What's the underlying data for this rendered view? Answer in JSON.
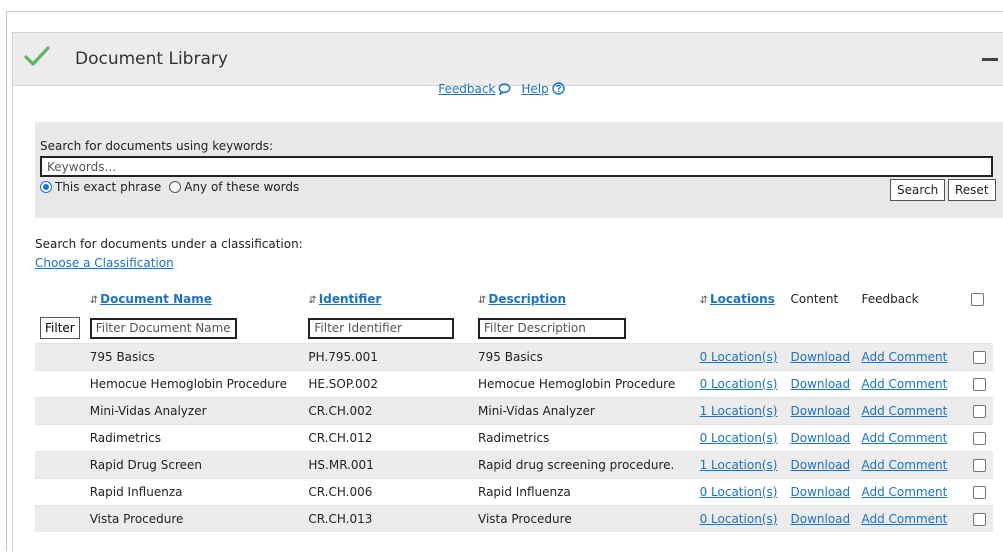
{
  "panel": {
    "title": "Document Library",
    "minimize_icon": "minus-icon",
    "status_icon": "check-icon",
    "accent_color": "#5cb85c"
  },
  "links": {
    "feedback": "Feedback",
    "feedback_icon": "speech-bubble-icon",
    "help": "Help",
    "help_icon": "question-circle-icon"
  },
  "search": {
    "label": "Search for documents using keywords:",
    "placeholder": "Keywords...",
    "value": "",
    "options": [
      {
        "label": "This exact phrase",
        "selected": true
      },
      {
        "label": "Any of these words",
        "selected": false
      }
    ],
    "search_button": "Search",
    "reset_button": "Reset"
  },
  "classification": {
    "label": "Search for documents under a classification:",
    "link": "Choose a Classification"
  },
  "table": {
    "headers": {
      "name": "Document Name",
      "identifier": "Identifier",
      "description": "Description",
      "locations": "Locations",
      "content": "Content",
      "feedback": "Feedback"
    },
    "filter_button": "Filter",
    "filters": {
      "name": "Filter Document Name",
      "identifier": "Filter Identifier",
      "description": "Filter Description"
    },
    "rows": [
      {
        "name": "795 Basics",
        "identifier": "PH.795.001",
        "description": "795 Basics",
        "locations": "0 Location(s)",
        "content": "Download",
        "feedback": "Add Comment"
      },
      {
        "name": "Hemocue Hemoglobin Procedure",
        "identifier": "HE.SOP.002",
        "description": "Hemocue Hemoglobin Procedure",
        "locations": "0 Location(s)",
        "content": "Download",
        "feedback": "Add Comment"
      },
      {
        "name": "Mini-Vidas Analyzer",
        "identifier": "CR.CH.002",
        "description": "Mini-Vidas Analyzer",
        "locations": "1 Location(s)",
        "content": "Download",
        "feedback": "Add Comment"
      },
      {
        "name": "Radimetrics",
        "identifier": "CR.CH.012",
        "description": "Radimetrics",
        "locations": "0 Location(s)",
        "content": "Download",
        "feedback": "Add Comment"
      },
      {
        "name": "Rapid Drug Screen",
        "identifier": "HS.MR.001",
        "description": "Rapid drug screening procedure.",
        "locations": "1 Location(s)",
        "content": "Download",
        "feedback": "Add Comment"
      },
      {
        "name": "Rapid Influenza",
        "identifier": "CR.CH.006",
        "description": "Rapid Influenza",
        "locations": "0 Location(s)",
        "content": "Download",
        "feedback": "Add Comment"
      },
      {
        "name": "Vista Procedure",
        "identifier": "CR.CH.013",
        "description": "Vista Procedure",
        "locations": "0 Location(s)",
        "content": "Download",
        "feedback": "Add Comment"
      }
    ]
  }
}
